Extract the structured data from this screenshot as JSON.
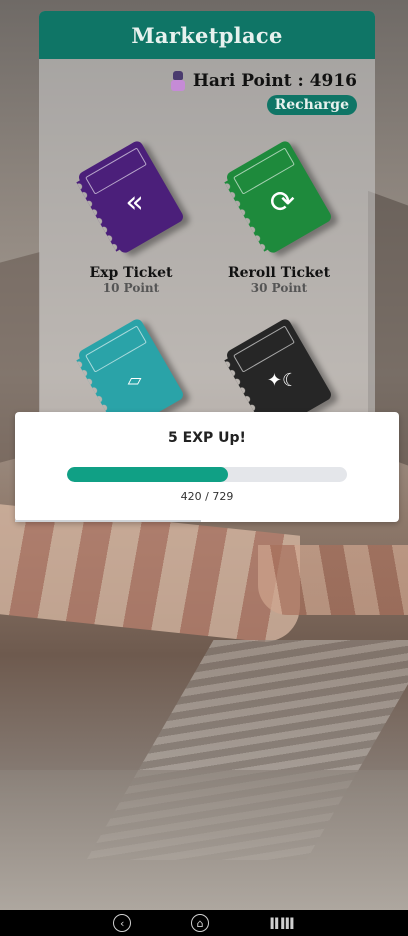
{
  "marketplace": {
    "title": "Marketplace",
    "points_label": "Hari Point : 4916",
    "recharge_label": "Recharge",
    "tickets": [
      {
        "name": "Exp Ticket",
        "price": "10 Point",
        "color": "#4b1f7a",
        "icon": "double-chevron-icon"
      },
      {
        "name": "Reroll Ticket",
        "price": "30 Point",
        "color": "#1e8a3c",
        "icon": "refresh-icon"
      },
      {
        "name": "",
        "price": "",
        "color": "#2aa3a8",
        "icon": "hint-card-icon"
      },
      {
        "name": "",
        "price": "",
        "color": "#262626",
        "icon": "stat-symbols-icon"
      }
    ]
  },
  "modal": {
    "title": "5 EXP Up!",
    "progress_text": "420 / 729",
    "progress_fraction": 0.576,
    "accent_color": "#10a085"
  },
  "navbar": {
    "back_icon": "back-chevron-icon",
    "home_icon": "home-icon",
    "right_label": "ⅡⅢ"
  }
}
